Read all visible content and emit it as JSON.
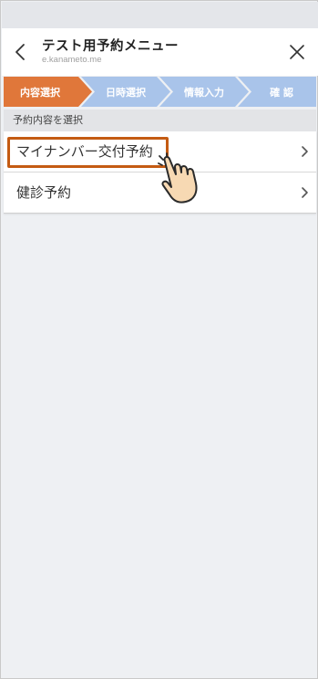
{
  "header": {
    "title": "テスト用予約メニュー",
    "subtitle": "e.kaname to.me",
    "back_icon": "chevron-left-icon",
    "close_icon": "close-icon"
  },
  "steps": [
    {
      "label": "内容選択",
      "active": true
    },
    {
      "label": "日時選択",
      "active": false
    },
    {
      "label": "情報入力",
      "active": false
    },
    {
      "label": "確 認",
      "active": false
    }
  ],
  "colors": {
    "step_active": "#e0773a",
    "step_inactive": "#a9c4ea",
    "highlight": "#c45b13",
    "hand_fill": "#f7d9b3"
  },
  "section": {
    "label": "予約内容を選択"
  },
  "items": [
    {
      "label": "マイナンバー交付予約"
    },
    {
      "label": "健診予約"
    }
  ],
  "overlay": {
    "hand_icon": "pointing-hand-icon"
  }
}
